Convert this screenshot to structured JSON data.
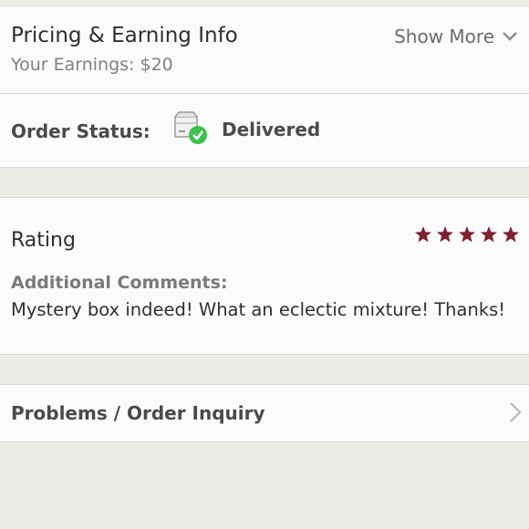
{
  "pricing": {
    "title": "Pricing & Earning Info",
    "earnings": "Your Earnings: $20",
    "show_more": "Show More"
  },
  "order_status": {
    "label": "Order Status:",
    "value": "Delivered",
    "icon": "delivered-box-icon"
  },
  "rating": {
    "label": "Rating",
    "stars": 5,
    "max_stars": 5,
    "star_color": "#7d2330",
    "comments_label": "Additional Comments:",
    "comments": "Mystery box indeed! What an eclectic mixture! Thanks!"
  },
  "inquiry": {
    "label": "Problems / Order Inquiry"
  },
  "colors": {
    "background": "#edebe8",
    "card": "#fbfbfb",
    "check_green": "#3ec14f"
  }
}
